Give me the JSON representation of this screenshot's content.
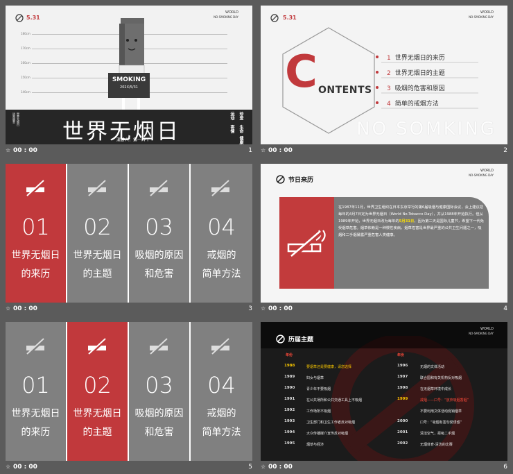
{
  "footer": {
    "time": "00 : 00",
    "star": "☆"
  },
  "slide1": {
    "date": "5.31",
    "world": "WORLD",
    "nsd": "NO-SMOKING DAY",
    "ruler": [
      "180cm",
      "170cm",
      "160cm",
      "150cm",
      "140cm"
    ],
    "sign": "SMOKING",
    "sign_date": "202X/5/31",
    "title": "世界无烟日",
    "speaker": "演讲人：第一PPT",
    "right_vertical": [
      "运动",
      "寄情",
      "珍爱",
      "生命",
      "健康"
    ],
    "left_vertical": [
      "远离烟草",
      "世界无烟日"
    ],
    "num": "1"
  },
  "slide2": {
    "date": "5.31",
    "world": "WORLD",
    "nsd": "NO-SMOKING DAY",
    "big_letter": "C",
    "rest": "ONTENTS",
    "toc": [
      {
        "n": "1",
        "label": "世界无烟日的来历"
      },
      {
        "n": "2",
        "label": "世界无烟日的主题"
      },
      {
        "n": "3",
        "label": "吸烟的危害和原因"
      },
      {
        "n": "4",
        "label": "简单的戒烟方法"
      }
    ],
    "watermark": "NO SOMKING",
    "num": "2"
  },
  "slide3": {
    "tiles": [
      {
        "num": "01",
        "l1": "世界无烟日",
        "l2": "的来历"
      },
      {
        "num": "02",
        "l1": "世界无烟日",
        "l2": "的主题"
      },
      {
        "num": "03",
        "l1": "吸烟的原因",
        "l2": "和危害"
      },
      {
        "num": "04",
        "l1": "戒烟的",
        "l2": "简单方法"
      }
    ],
    "num": "3"
  },
  "slide4": {
    "title": "节日来历",
    "world": "WORLD",
    "nsd": "NO-SMOKING DAY",
    "p1": "在1987年11月，世界卫生组织在日本东京举行的第6届吸烟与健康国际会议，会上建议把每年的4月7日定为世界无烟日（World No-Tobacco Day），并从1988年开始执行。但从1989年开始，世界无烟日改为每年的",
    "hi": "5月31日",
    "p2": "，因为第二天是国际儿童节，希望下一代免受烟草危害。烟草依赖是一种慢性疾病，烟草危害是世界最严重的公共卫生问题之一，吸烟和二手烟暴露严重危害人类健康。",
    "num": "4"
  },
  "slide5": {
    "tiles": [
      {
        "num": "01",
        "l1": "世界无烟日",
        "l2": "的来历"
      },
      {
        "num": "02",
        "l1": "世界无烟日",
        "l2": "的主题"
      },
      {
        "num": "03",
        "l1": "吸烟的原因",
        "l2": "和危害"
      },
      {
        "num": "04",
        "l1": "戒烟的",
        "l2": "简单方法"
      }
    ],
    "num": "5"
  },
  "slide6": {
    "title": "历届主题",
    "world": "WORLD",
    "nsd": "NO-SMOKING DAY",
    "head_year": "年份",
    "left": [
      {
        "y": "1988",
        "t": "要烟草还是要健康，请您选择"
      },
      {
        "y": "1989",
        "t": "妇女与烟草"
      },
      {
        "y": "1990",
        "t": "青少年不要吸烟"
      },
      {
        "y": "1991",
        "t": "在公共场所和公共交通工具上不吸烟"
      },
      {
        "y": "1992",
        "t": "工作场所不吸烟"
      },
      {
        "y": "1993",
        "t": "卫生部门和卫生工作者反对吸烟"
      },
      {
        "y": "1994",
        "t": "大众传播媒介宣传反对吸烟"
      },
      {
        "y": "1995",
        "t": "烟草与经济"
      }
    ],
    "right": [
      {
        "y": "1996",
        "t": "无烟的文体活动"
      },
      {
        "y": "1997",
        "t": "联合国和有关机构反对吸烟"
      },
      {
        "y": "1998",
        "t": "在无烟草环境中成长"
      },
      {
        "y": "1999",
        "t": "戒烟——口号：“放弃吸烟香烟”"
      },
      {
        "y": "",
        "t": "不要利用文体活动促销烟草"
      },
      {
        "y": "2000",
        "t": "口号：“吸烟有害勿受诱惑”"
      },
      {
        "y": "2001",
        "t": "清洁空气，拒吸二手烟"
      },
      {
        "y": "2002",
        "t": "无烟体育-清洁的比赛"
      }
    ],
    "num": "6"
  },
  "colors": {
    "accent": "#c1393c",
    "tile": "#808080",
    "highlight": "#f7c500"
  }
}
